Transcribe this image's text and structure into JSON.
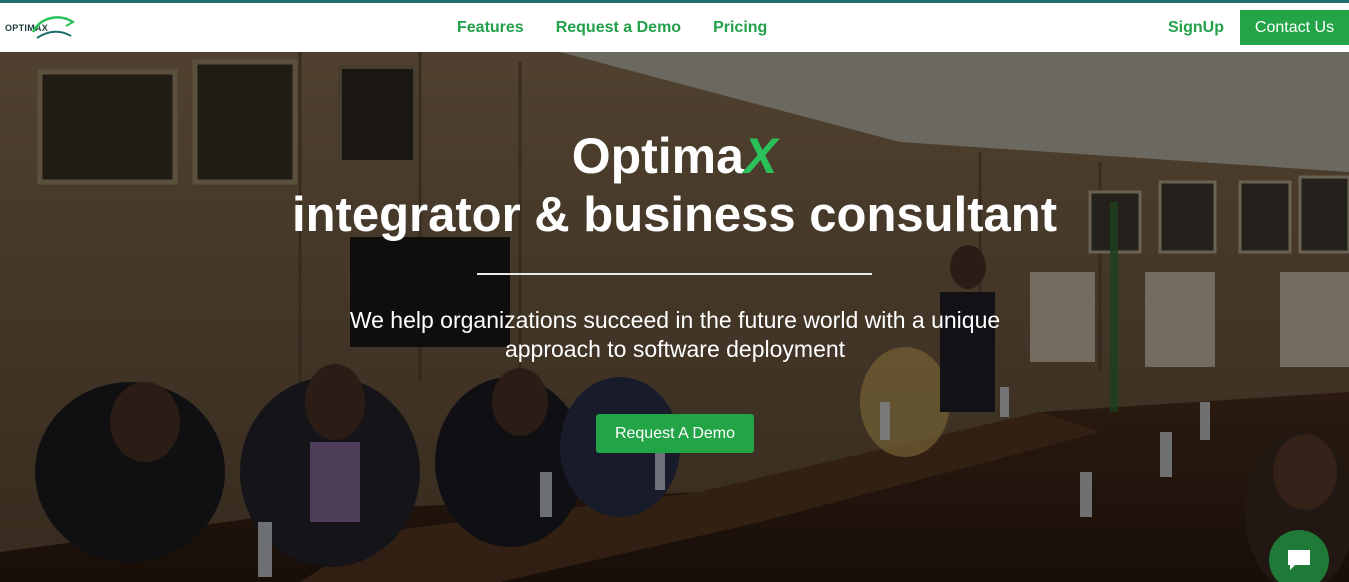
{
  "header": {
    "logo_text": "OPTIMAX",
    "nav_items": [
      {
        "label": "Features"
      },
      {
        "label": "Request a Demo"
      },
      {
        "label": "Pricing"
      }
    ],
    "signup_label": "SignUp",
    "contact_label": "Contact Us"
  },
  "hero": {
    "title_main": "Optima",
    "title_accent": "X",
    "subtitle": "integrator & business consultant",
    "description": "We help organizations succeed in the future world with a unique approach to software deployment",
    "cta_label": "Request A Demo",
    "background_image": "conference-room-meeting-photo"
  },
  "chat_widget": {
    "icon": "chat-icon"
  },
  "colors": {
    "brand_green": "#22a447",
    "nav_text": "#23a04a",
    "accent_x": "#2bc15a",
    "top_border": "#1f6f6a"
  }
}
